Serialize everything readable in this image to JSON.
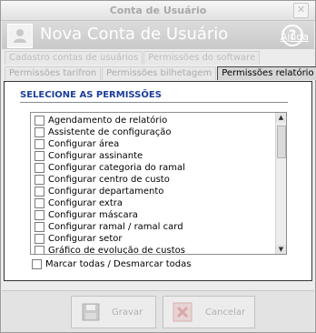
{
  "window": {
    "title": "Conta de Usuário",
    "close_glyph": "✕"
  },
  "header": {
    "title": "Nova Conta de Usuário",
    "help_label": "Ajuda",
    "help_glyph": "?"
  },
  "tabs_row1": [
    {
      "label": "Cadastro contas de usuários",
      "state": "enabled"
    },
    {
      "label": "Permissões do software",
      "state": "enabled"
    }
  ],
  "tabs_row2": [
    {
      "label": "Permissões tarifron",
      "state": "enabled"
    },
    {
      "label": "Permissões bilhetagem",
      "state": "enabled"
    },
    {
      "label": "Permissões relatório",
      "state": "selected"
    }
  ],
  "section": {
    "title": "SELECIONE AS PERMISSÕES"
  },
  "permissions": [
    {
      "label": "Agendamento de relatório",
      "checked": false
    },
    {
      "label": "Assistente de configuração",
      "checked": false
    },
    {
      "label": "Configurar área",
      "checked": false
    },
    {
      "label": "Configurar assinante",
      "checked": false
    },
    {
      "label": "Configurar categoria do ramal",
      "checked": false
    },
    {
      "label": "Configurar centro de custo",
      "checked": false
    },
    {
      "label": "Configurar departamento",
      "checked": false
    },
    {
      "label": "Configurar extra",
      "checked": false
    },
    {
      "label": "Configurar máscara",
      "checked": false
    },
    {
      "label": "Configurar ramal / ramal card",
      "checked": false
    },
    {
      "label": "Configurar setor",
      "checked": false
    },
    {
      "label": "Gráfico de evolução de custos",
      "checked": false
    }
  ],
  "mark_all": {
    "label": "Marcar todas / Desmarcar todas",
    "checked": false
  },
  "buttons": {
    "save": "Gravar",
    "cancel": "Cancelar"
  },
  "colors": {
    "section_title": "#1c3d9c",
    "header_bg": "#cfcfcf",
    "selected_tab_border": "#444444"
  }
}
